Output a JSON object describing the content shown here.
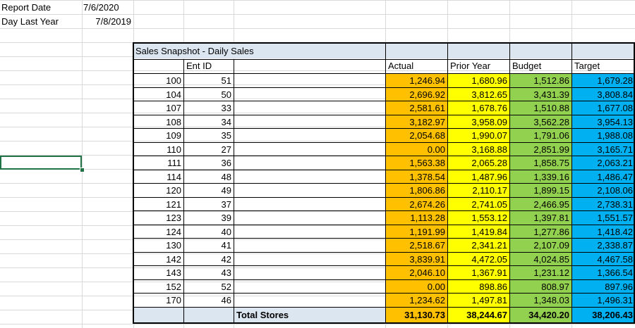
{
  "report": {
    "report_date_label": "Report Date",
    "report_date_value": "7/6/2020",
    "day_last_year_label": "Day Last Year",
    "day_last_year_value": "7/8/2019"
  },
  "table": {
    "title": "Sales Snapshot - Daily Sales",
    "headers": {
      "ent_id": "Ent ID",
      "actual": "Actual",
      "prior_year": "Prior Year",
      "budget": "Budget",
      "target": "Target"
    },
    "colors": {
      "actual": "#ffc000",
      "prior_year": "#ffff00",
      "budget": "#92d050",
      "target": "#00b0f0",
      "header_band": "#dce6f1"
    },
    "rows": [
      {
        "store": "100",
        "ent": "51",
        "actual": "1,246.94",
        "prior": "1,680.96",
        "budget": "1,512.86",
        "target": "1,679.28"
      },
      {
        "store": "104",
        "ent": "50",
        "actual": "2,696.92",
        "prior": "3,812.65",
        "budget": "3,431.39",
        "target": "3,808.84"
      },
      {
        "store": "107",
        "ent": "33",
        "actual": "2,581.61",
        "prior": "1,678.76",
        "budget": "1,510.88",
        "target": "1,677.08"
      },
      {
        "store": "108",
        "ent": "34",
        "actual": "3,182.97",
        "prior": "3,958.09",
        "budget": "3,562.28",
        "target": "3,954.13"
      },
      {
        "store": "109",
        "ent": "35",
        "actual": "2,054.68",
        "prior": "1,990.07",
        "budget": "1,791.06",
        "target": "1,988.08"
      },
      {
        "store": "110",
        "ent": "27",
        "actual": "0.00",
        "prior": "3,168.88",
        "budget": "2,851.99",
        "target": "3,165.71"
      },
      {
        "store": "111",
        "ent": "36",
        "actual": "1,563.38",
        "prior": "2,065.28",
        "budget": "1,858.75",
        "target": "2,063.21"
      },
      {
        "store": "114",
        "ent": "48",
        "actual": "1,378.54",
        "prior": "1,487.96",
        "budget": "1,339.16",
        "target": "1,486.47"
      },
      {
        "store": "120",
        "ent": "49",
        "actual": "1,806.86",
        "prior": "2,110.17",
        "budget": "1,899.15",
        "target": "2,108.06"
      },
      {
        "store": "121",
        "ent": "37",
        "actual": "2,674.26",
        "prior": "2,741.05",
        "budget": "2,466.95",
        "target": "2,738.31"
      },
      {
        "store": "123",
        "ent": "39",
        "actual": "1,113.28",
        "prior": "1,553.12",
        "budget": "1,397.81",
        "target": "1,551.57"
      },
      {
        "store": "124",
        "ent": "40",
        "actual": "1,191.99",
        "prior": "1,419.84",
        "budget": "1,277.86",
        "target": "1,418.42"
      },
      {
        "store": "130",
        "ent": "41",
        "actual": "2,518.67",
        "prior": "2,341.21",
        "budget": "2,107.09",
        "target": "2,338.87"
      },
      {
        "store": "142",
        "ent": "42",
        "actual": "3,839.91",
        "prior": "4,472.05",
        "budget": "4,024.85",
        "target": "4,467.58"
      },
      {
        "store": "143",
        "ent": "43",
        "actual": "2,046.10",
        "prior": "1,367.91",
        "budget": "1,231.12",
        "target": "1,366.54"
      },
      {
        "store": "152",
        "ent": "52",
        "actual": "0.00",
        "prior": "898.86",
        "budget": "808.97",
        "target": "897.96"
      },
      {
        "store": "170",
        "ent": "46",
        "actual": "1,234.62",
        "prior": "1,497.81",
        "budget": "1,348.03",
        "target": "1,496.31"
      }
    ],
    "totals": {
      "label": "Total Stores",
      "actual": "31,130.73",
      "prior": "38,244.67",
      "budget": "34,420.20",
      "target": "38,206.43"
    }
  }
}
